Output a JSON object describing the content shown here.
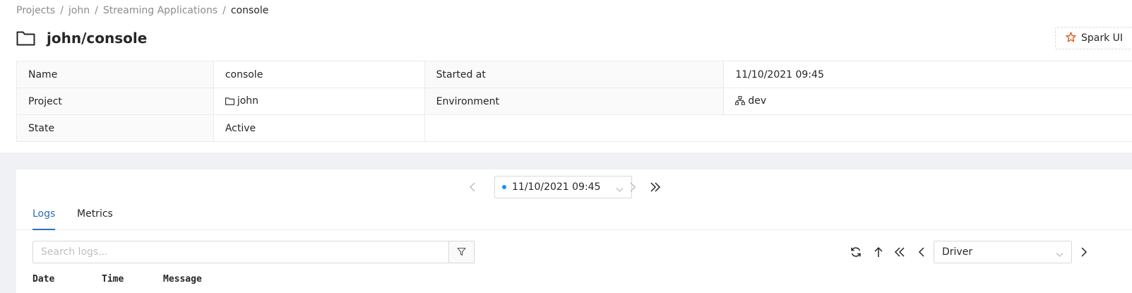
{
  "breadcrumb": {
    "items": [
      "Projects",
      "john",
      "Streaming Applications"
    ],
    "current": "console",
    "separator": "/"
  },
  "header": {
    "title": "john/console",
    "icon": "folder-icon",
    "spark_ui_label": "Spark UI"
  },
  "details": {
    "name_label": "Name",
    "name_value": "console",
    "started_label": "Started at",
    "started_value": "11/10/2021 09:45",
    "project_label": "Project",
    "project_value": "john",
    "environment_label": "Environment",
    "environment_value": "dev",
    "state_label": "State",
    "state_value": "Active"
  },
  "run_selector": {
    "selected": "11/10/2021 09:45",
    "status_color": "#1890ff"
  },
  "tabs": [
    {
      "label": "Logs",
      "active": true
    },
    {
      "label": "Metrics",
      "active": false
    }
  ],
  "logs": {
    "search_placeholder": "Search logs...",
    "source_selected": "Driver",
    "columns": [
      "Date",
      "Time",
      "Message"
    ]
  },
  "colors": {
    "accent": "#2e6fb5",
    "spark_icon": "#e25a1c",
    "band": "#f0f1f4"
  }
}
